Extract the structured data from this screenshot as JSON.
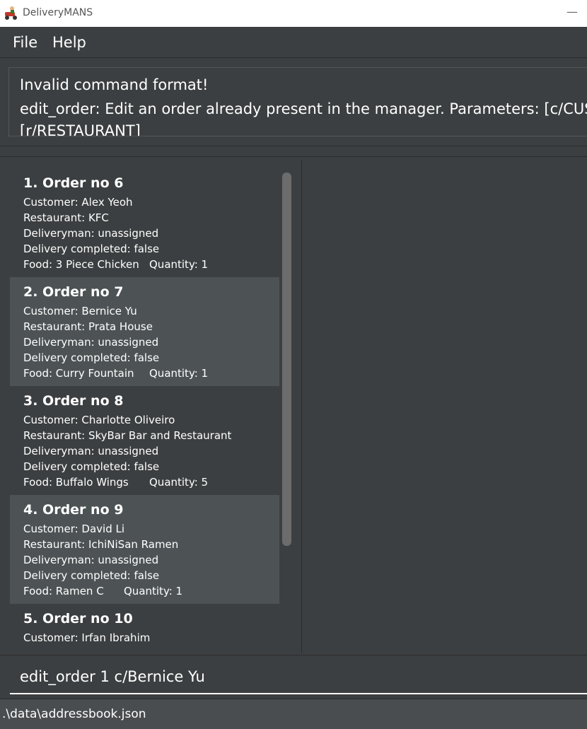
{
  "window": {
    "title": "DeliveryMANS",
    "minimize_label": "—"
  },
  "menu": {
    "file": "File",
    "help": "Help"
  },
  "result": {
    "line1": "Invalid command format!",
    "line2": "edit_order: Edit an order already present in the manager. Parameters: [c/CUSTOMER]",
    "line3": "[r/RESTAURANT]"
  },
  "orders": [
    {
      "title": "1.  Order no 6",
      "customer": "Customer: Alex Yeoh",
      "restaurant": "Restaurant: KFC",
      "deliveryman": "Deliveryman: unassigned",
      "completed": "Delivery completed: false",
      "food": "Food: 3 Piece Chicken",
      "quantity": "Quantity: 1"
    },
    {
      "title": "2.  Order no 7",
      "customer": "Customer: Bernice Yu",
      "restaurant": "Restaurant: Prata House",
      "deliveryman": "Deliveryman: unassigned",
      "completed": "Delivery completed: false",
      "food": "Food: Curry Fountain",
      "quantity": "Quantity: 1"
    },
    {
      "title": "3.  Order no 8",
      "customer": "Customer: Charlotte Oliveiro",
      "restaurant": "Restaurant: SkyBar Bar and Restaurant",
      "deliveryman": "Deliveryman: unassigned",
      "completed": "Delivery completed: false",
      "food": "Food: Buffalo Wings",
      "quantity": "Quantity: 5"
    },
    {
      "title": "4.  Order no 9",
      "customer": "Customer: David Li",
      "restaurant": "Restaurant: IchiNiSan Ramen",
      "deliveryman": "Deliveryman: unassigned",
      "completed": "Delivery completed: false",
      "food": "Food: Ramen C",
      "quantity": "Quantity: 1"
    },
    {
      "title": "5.  Order no 10",
      "customer": "Customer: Irfan Ibrahim"
    }
  ],
  "command": {
    "value": "edit_order 1 c/Bernice Yu"
  },
  "status": {
    "path": ".\\data\\addressbook.json"
  },
  "colors": {
    "background": "#3c3f41",
    "alt_row": "#4d5355",
    "text": "#ffffff",
    "status_bar": "#4a4d50"
  },
  "icons": {
    "app": "delivery-scooter-icon"
  }
}
